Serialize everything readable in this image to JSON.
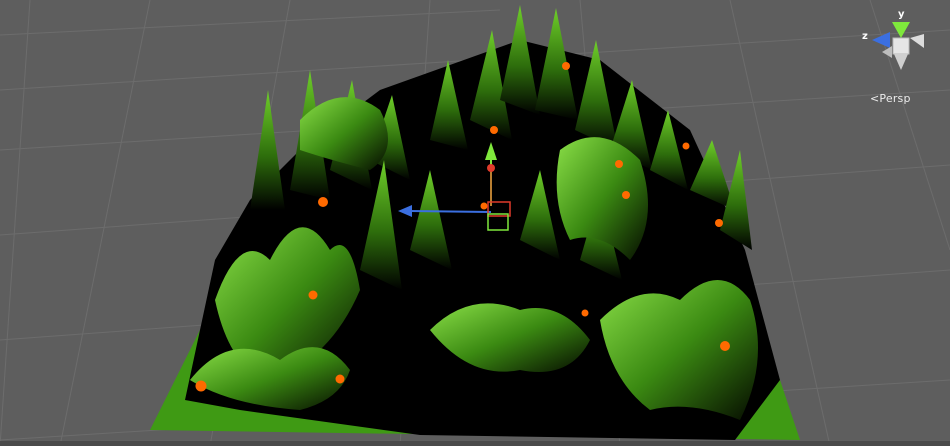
{
  "scene": {
    "background": "#5e5e5e",
    "terrain_green": "#4ba21a",
    "base_green": "#3f9a14",
    "marker_color": "#ff6a00"
  },
  "gizmo": {
    "axis_y_label": "y",
    "axis_z_label": "z",
    "projection_label": "Persp",
    "icons": {
      "projection": "chevron-left-icon"
    }
  },
  "transform_handle": {
    "y_axis_color": "#7fe83c",
    "z_axis_color": "#3b6fe0",
    "x_axis_color": "#e03b2b"
  }
}
